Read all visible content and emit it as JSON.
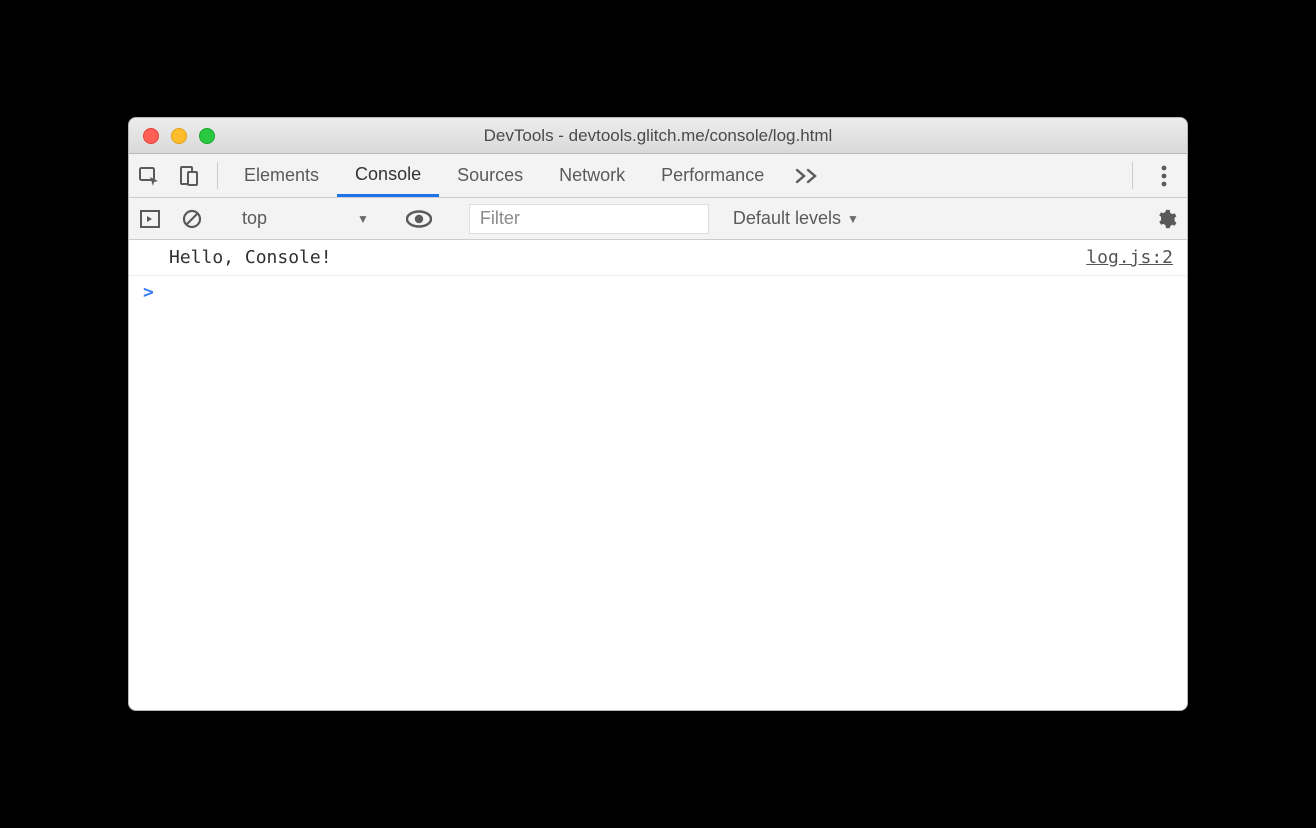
{
  "window": {
    "title": "DevTools - devtools.glitch.me/console/log.html"
  },
  "tabs": {
    "items": [
      "Elements",
      "Console",
      "Sources",
      "Network",
      "Performance"
    ],
    "active": "Console"
  },
  "toolbar": {
    "context": "top",
    "filter_placeholder": "Filter",
    "levels_label": "Default levels"
  },
  "console": {
    "rows": [
      {
        "message": "Hello, Console!",
        "source": "log.js:2"
      }
    ],
    "prompt": ">"
  }
}
